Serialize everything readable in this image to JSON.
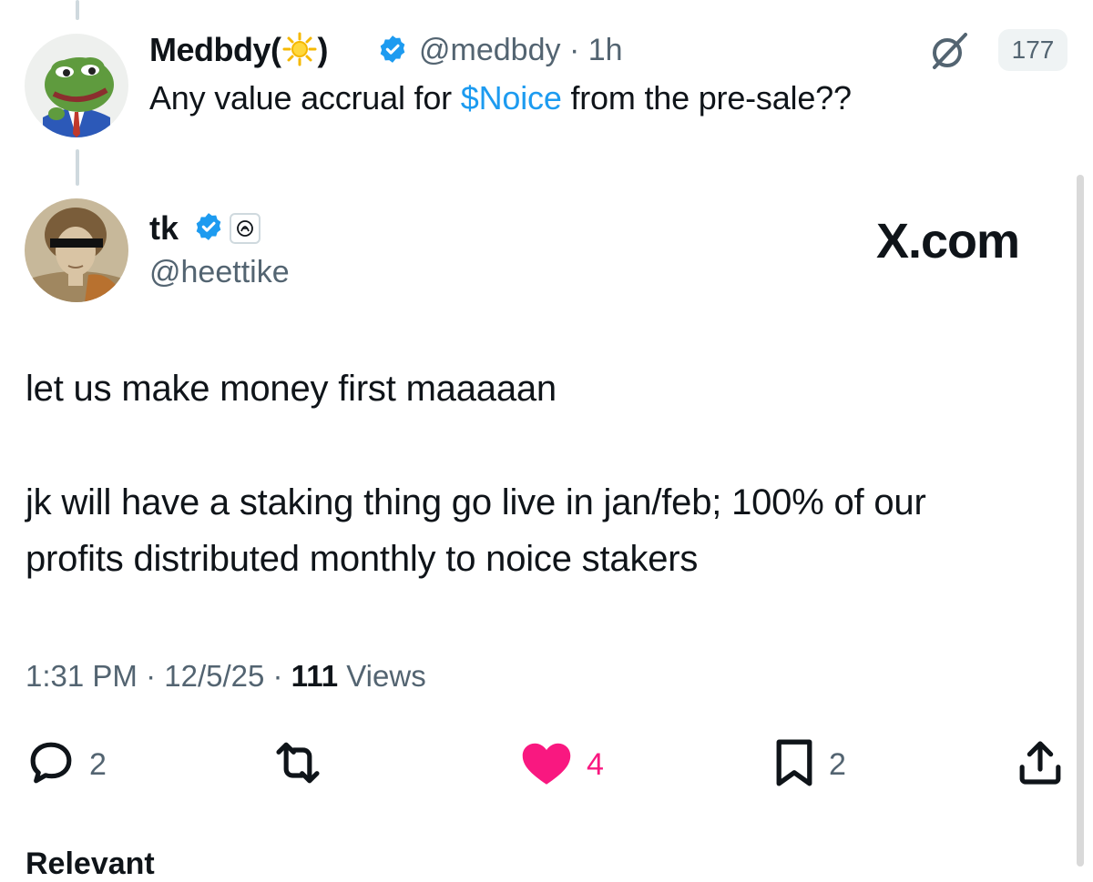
{
  "parent_tweet": {
    "display_name": "Medbdy(",
    "display_name_emoji": "sun-emoji",
    "display_name_suffix": ")",
    "handle": "@medbdy",
    "separator": "·",
    "time_ago": "1h",
    "text_before": "Any value accrual for ",
    "cashtag": "$Noice",
    "text_after": " from the pre-sale??",
    "reply_count_badge": "177"
  },
  "main_tweet": {
    "display_name": "tk",
    "handle": "@heettike",
    "watermark": "X.com",
    "body_line_1": "let us make money first maaaaan",
    "body_line_2": "jk will have a staking thing go live in jan/feb; 100% of our",
    "body_line_3": "profits distributed monthly to noice stakers",
    "time": "1:31 PM",
    "sep1": " · ",
    "date": "12/5/25",
    "sep2": " · ",
    "views_count": "111",
    "views_label": " Views"
  },
  "actions": {
    "replies": "2",
    "likes": "4",
    "bookmarks": "2"
  },
  "icons": {
    "verified_color": "#1d9bf0",
    "like_color": "#f91880"
  },
  "footer": {
    "relevant_label": "Relevant"
  }
}
